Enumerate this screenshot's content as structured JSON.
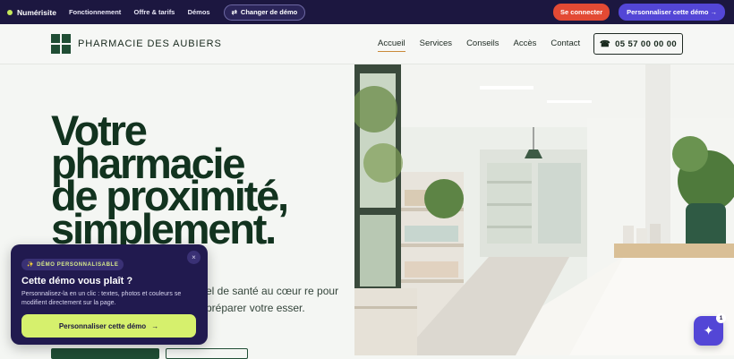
{
  "topbar": {
    "brand": "Numérisite",
    "nav": [
      "Fonctionnement",
      "Offre & tarifs",
      "Démos"
    ],
    "switch_label": "Changer de démo",
    "login_label": "Se connecter",
    "customize_label": "Personnaliser cette démo →"
  },
  "header": {
    "logo_text": "PHARMACIE DES AUBIERS",
    "nav": [
      "Accueil",
      "Services",
      "Conseils",
      "Accès",
      "Contact"
    ],
    "active_nav": "Accueil",
    "phone": "05 57 00 00 00"
  },
  "hero": {
    "title_lines": [
      "Votre",
      "pharmacie",
      "de proximité,",
      "simplement."
    ],
    "subtitle": "el de santé au cœur re pour préparer votre esser."
  },
  "popup": {
    "badge": "DÉMO PERSONNALISABLE",
    "title": "Cette démo vous plaît ?",
    "text": "Personnalisez-la en un clic : textes, photos et couleurs se modifient directement sur la page.",
    "cta": "Personnaliser cette démo",
    "cta_arrow": "→",
    "close": "×"
  },
  "assistant": {
    "badge_count": "1"
  },
  "colors": {
    "brand_dark": "#1c1740",
    "accent_purple": "#5346d6",
    "cta_lime": "#d6f06d",
    "pharmacy_green": "#1f4d34",
    "login_red": "#e34a34"
  }
}
